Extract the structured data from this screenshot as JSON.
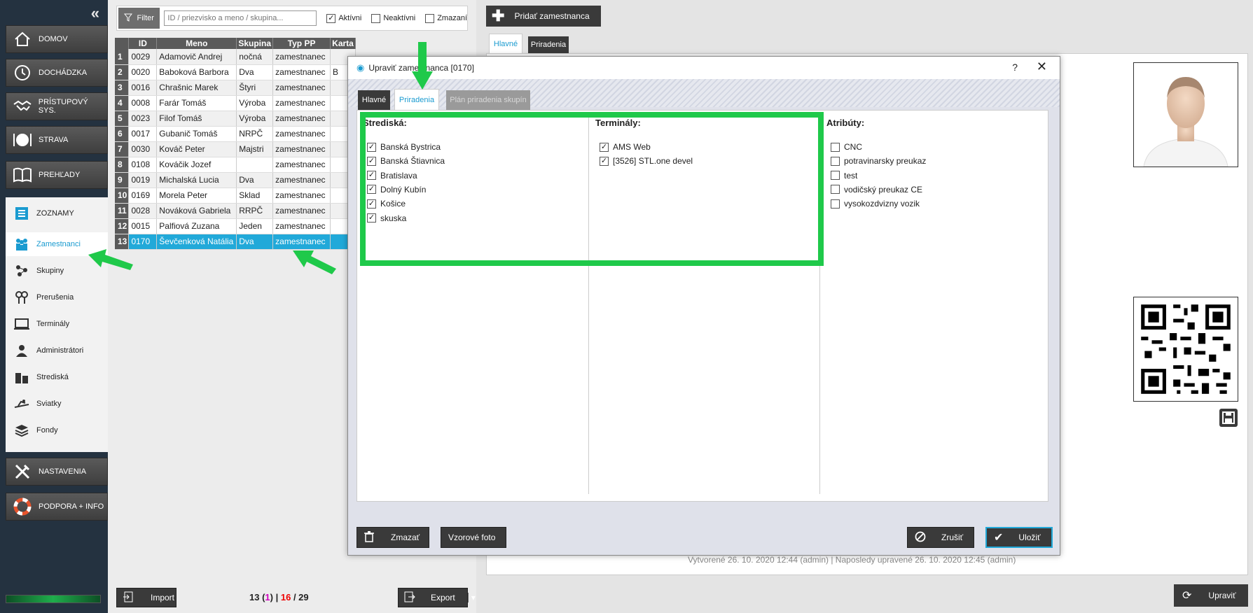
{
  "sidebar": {
    "collapse_icon": "chevrons-left-icon",
    "nav": [
      {
        "label": "DOMOV",
        "icon": "home-icon"
      },
      {
        "label": "DOCHÁDZKA",
        "icon": "clock-icon"
      },
      {
        "label": "PRÍSTUPOVÝ SYS.",
        "icon": "handshake-icon"
      },
      {
        "label": "STRAVA",
        "icon": "plate-icon"
      },
      {
        "label": "PREHĽADY",
        "icon": "book-icon"
      }
    ],
    "lists_header": "ZOZNAMY",
    "sub": [
      {
        "label": "Zamestnanci",
        "icon": "people-icon",
        "active": true
      },
      {
        "label": "Skupiny",
        "icon": "group-icon"
      },
      {
        "label": "Prerušenia",
        "icon": "pins-icon"
      },
      {
        "label": "Terminály",
        "icon": "monitor-icon"
      },
      {
        "label": "Administrátori",
        "icon": "admin-icon"
      },
      {
        "label": "Strediská",
        "icon": "building-icon"
      },
      {
        "label": "Sviatky",
        "icon": "holiday-icon"
      },
      {
        "label": "Fondy",
        "icon": "layers-icon"
      }
    ],
    "bottom": [
      {
        "label": "NASTAVENIA",
        "icon": "tools-icon"
      },
      {
        "label": "PODPORA + INFO",
        "icon": "lifebuoy-icon"
      }
    ]
  },
  "filter": {
    "button": "Filter",
    "placeholder": "ID / priezvisko a meno / skupina...",
    "active_label": "Aktívni",
    "inactive_label": "Neaktívni",
    "deleted_label": "Zmazaní"
  },
  "table": {
    "headers": [
      "ID",
      "Meno",
      "Skupina",
      "Typ PP",
      "Karta"
    ],
    "rows": [
      {
        "n": "1",
        "id": "0029",
        "name": "Adamovič Andrej",
        "group": "nočná",
        "type": "zamestnanec",
        "card": ""
      },
      {
        "n": "2",
        "id": "0020",
        "name": "Baboková Barbora",
        "group": "Dva",
        "type": "zamestnanec",
        "card": "B"
      },
      {
        "n": "3",
        "id": "0016",
        "name": "Chrašnic Marek",
        "group": "Štyri",
        "type": "zamestnanec",
        "card": ""
      },
      {
        "n": "4",
        "id": "0008",
        "name": "Farár Tomáš",
        "group": "Výroba",
        "type": "zamestnanec",
        "card": ""
      },
      {
        "n": "5",
        "id": "0023",
        "name": "Filof Tomáš",
        "group": "Výroba",
        "type": "zamestnanec",
        "card": ""
      },
      {
        "n": "6",
        "id": "0017",
        "name": "Gubanič Tomáš",
        "group": "NRPČ",
        "type": "zamestnanec",
        "card": ""
      },
      {
        "n": "7",
        "id": "0030",
        "name": "Kováč Peter",
        "group": "Majstri",
        "type": "zamestnanec",
        "card": ""
      },
      {
        "n": "8",
        "id": "0108",
        "name": "Kováčik Jozef",
        "group": "",
        "type": "zamestnanec",
        "card": ""
      },
      {
        "n": "9",
        "id": "0019",
        "name": "Michalská Lucia",
        "group": "Dva",
        "type": "zamestnanec",
        "card": ""
      },
      {
        "n": "10",
        "id": "0169",
        "name": "Morela Peter",
        "group": "Sklad",
        "type": "zamestnanec",
        "card": ""
      },
      {
        "n": "11",
        "id": "0028",
        "name": "Nováková Gabriela",
        "group": "RRPČ",
        "type": "zamestnanec",
        "card": ""
      },
      {
        "n": "12",
        "id": "0015",
        "name": "Palfiová Zuzana",
        "group": "Jeden",
        "type": "zamestnanec",
        "card": ""
      },
      {
        "n": "13",
        "id": "0170",
        "name": "Ševčenková Natália",
        "group": "Dva",
        "type": "zamestnanec",
        "card": ""
      }
    ]
  },
  "list_footer": {
    "import_label": "Import",
    "export_label": "Export",
    "count_selected": "13",
    "count_pink": "1",
    "count_red": "16",
    "count_total": "29"
  },
  "right": {
    "add_label": "Pridať zamestnanca",
    "tab_main": "Hlavné",
    "tab_assign": "Priradenia",
    "footer_info": "Vytvorené 26. 10. 2020 12:44 (admin) | Naposledy upravené 26. 10. 2020 12:45 (admin)",
    "update_label": "Upraviť"
  },
  "dialog": {
    "title": "Upraviť zamestnanca [0170]",
    "help": "?",
    "tabs": [
      "Hlavné",
      "Priradenia",
      "Plán priradenia skupín"
    ],
    "centers_title": "Strediská:",
    "centers": [
      "Banská Bystrica",
      "Banská Štiavnica",
      "Bratislava",
      "Dolný Kubín",
      "Košice",
      "skuska"
    ],
    "terminals_title": "Terminály:",
    "terminals": [
      "AMS Web",
      "[3526] STL.one devel"
    ],
    "attrs_title": "Atribúty:",
    "attrs": [
      "CNC",
      "potravinarsky preukaz",
      "test",
      "vodičský preukaz CE",
      "vysokozdvizny vozik"
    ],
    "delete_label": "Zmazať",
    "photo_label": "Vzorové foto",
    "cancel_label": "Zrušiť",
    "save_label": "Uložiť"
  },
  "colors": {
    "accent": "#21a9d9",
    "highlight": "#1fc94a",
    "dark": "#3a3a3a"
  }
}
